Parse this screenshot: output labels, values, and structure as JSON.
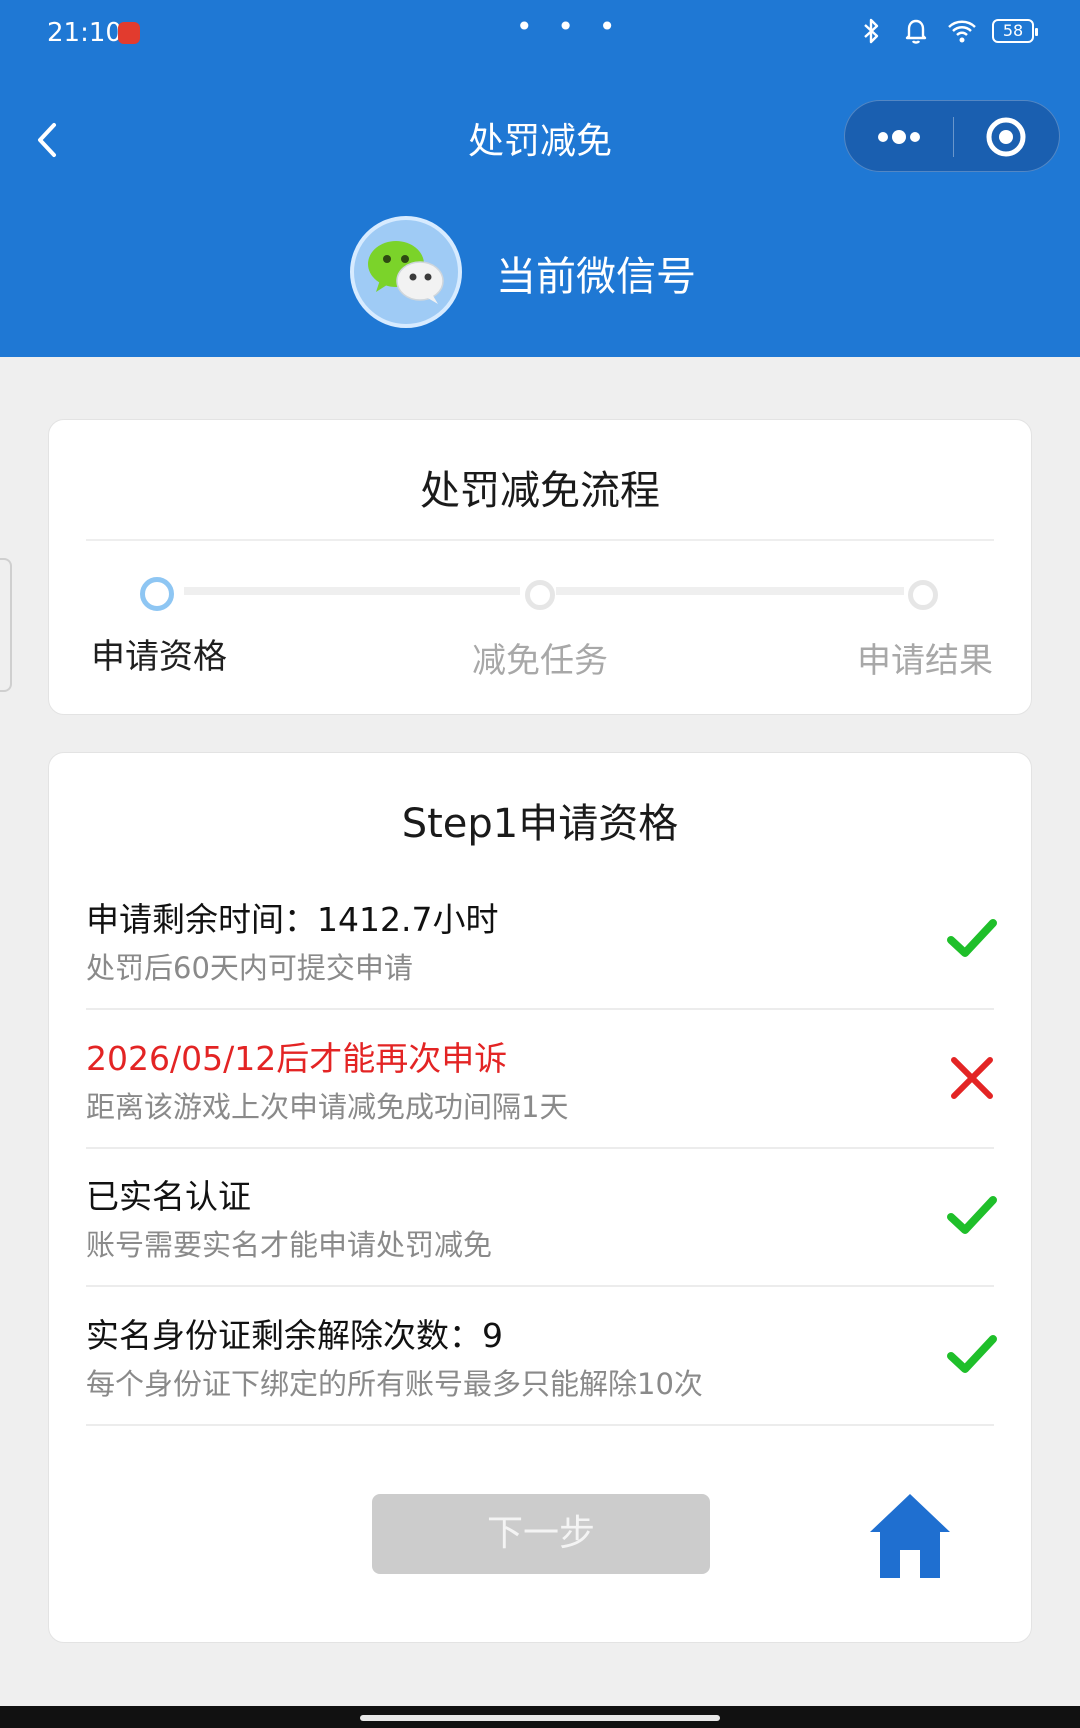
{
  "status_bar": {
    "time": "21:10",
    "dots": "• • •",
    "battery": "58"
  },
  "nav": {
    "title": "处罚减免",
    "icons": {
      "back": "chevron-left-icon",
      "more": "more-dots-icon",
      "close": "target-close-icon"
    }
  },
  "account": {
    "label": "当前微信号",
    "avatar_icon": "wechat-icon"
  },
  "process_card": {
    "title": "处罚减免流程",
    "steps": [
      {
        "label": "申请资格",
        "state": "active"
      },
      {
        "label": "减免任务",
        "state": "inactive"
      },
      {
        "label": "申请结果",
        "state": "inactive"
      }
    ]
  },
  "step_card": {
    "title": "Step1申请资格",
    "requirements": [
      {
        "title": "申请剩余时间：1412.7小时",
        "desc": "处罚后60天内可提交申请",
        "status": "check",
        "title_color": "normal"
      },
      {
        "title": "2026/05/12后才能再次申诉",
        "desc": "距离该游戏上次申请减免成功间隔1天",
        "status": "cross",
        "title_color": "error"
      },
      {
        "title": "已实名认证",
        "desc": "账号需要实名才能申请处罚减免",
        "status": "check",
        "title_color": "normal"
      },
      {
        "title": "实名身份证剩余解除次数：9",
        "desc": "每个身份证下绑定的所有账号最多只能解除10次",
        "status": "check",
        "title_color": "normal"
      }
    ],
    "next_label": "下一步",
    "home_icon": "home-icon"
  },
  "colors": {
    "header_blue": "#1f78d4",
    "check_green": "#1fbf2a",
    "cross_red": "#e32424",
    "home_blue": "#1f6fd0",
    "error_text": "#e32424"
  }
}
